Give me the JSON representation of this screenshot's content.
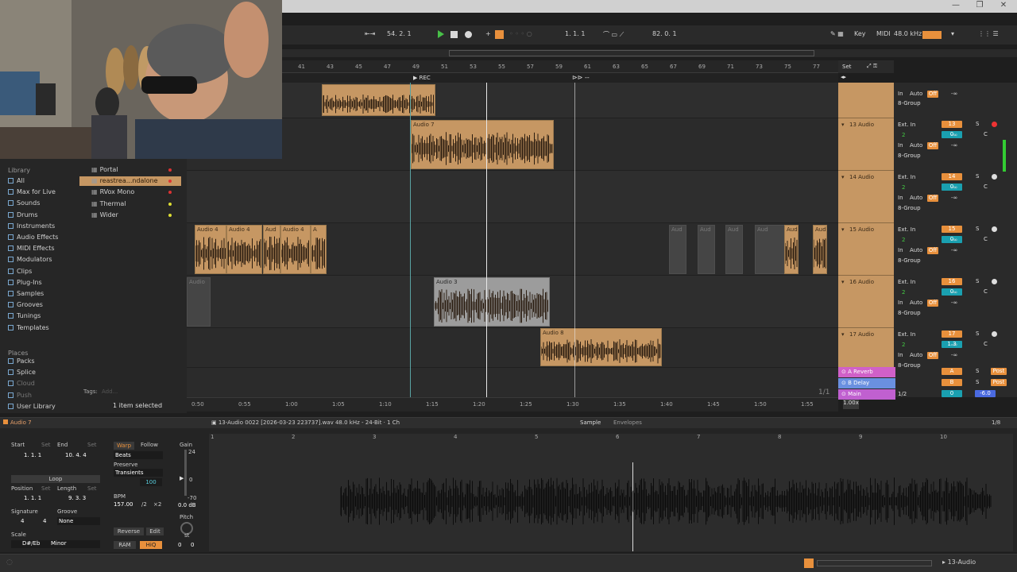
{
  "window": {
    "minimize": "—",
    "restore": "❐",
    "close": "✕"
  },
  "transport": {
    "loop_pos": "54.  2.  1",
    "position": "1.  1.  1",
    "tempo": "82.  0.  1",
    "key_label": "Key",
    "midi_label": "MIDI",
    "sample_rate": "48.0 kHz"
  },
  "ruler": {
    "bars": [
      "41",
      "43",
      "45",
      "47",
      "49",
      "51",
      "53",
      "55",
      "57",
      "59",
      "61",
      "63",
      "65",
      "67",
      "69",
      "71",
      "73",
      "75",
      "77"
    ],
    "rec_label": "REC",
    "set_label": "Set"
  },
  "time_ticks": [
    "0:50",
    "0:55",
    "1:00",
    "1:05",
    "1:10",
    "1:15",
    "1:20",
    "1:25",
    "1:30",
    "1:35",
    "1:40",
    "1:45",
    "1:50",
    "1:55"
  ],
  "browser": {
    "library_title": "Library",
    "items": [
      "All",
      "Max for Live",
      "Sounds",
      "Drums",
      "Instruments",
      "Audio Effects",
      "MIDI Effects",
      "Modulators",
      "Clips",
      "Plug-Ins",
      "Samples",
      "Grooves",
      "Tunings",
      "Templates"
    ],
    "places_title": "Places",
    "places": [
      "Packs",
      "Splice",
      "Cloud",
      "Push",
      "User Library"
    ],
    "folder_items": [
      "Portal",
      "reastrea...ndalone",
      "RVox Mono",
      "Thermal",
      "Wider"
    ],
    "tags_label": "Tags:",
    "tags_placeholder": "Add...",
    "selected_text": "1 item selected"
  },
  "clips": {
    "audio7": "Audio 7",
    "audio3": "Audio 3",
    "audio8": "Audio 8",
    "audio4a": "Audio 4",
    "audio4b": "Audio 4",
    "audio4c": "Aud",
    "audio4d": "Audio 4",
    "audio4e": "A",
    "audio_dim": "Audio",
    "aud": "Aud"
  },
  "tracks": [
    {
      "name": "13 Audio",
      "num": "13",
      "input": "Ext. In",
      "ch": "2",
      "vol": "0",
      "pan": "C"
    },
    {
      "name": "14 Audio",
      "num": "14",
      "input": "Ext. In",
      "ch": "2",
      "vol": "0",
      "pan": "C"
    },
    {
      "name": "15 Audio",
      "num": "15",
      "input": "Ext. In",
      "ch": "2",
      "vol": "0",
      "pan": "C"
    },
    {
      "name": "16 Audio",
      "num": "16",
      "input": "Ext. In",
      "ch": "2",
      "vol": "0",
      "pan": "C"
    },
    {
      "name": "17 Audio",
      "num": "17",
      "input": "Ext. In",
      "ch": "2",
      "vol": "1.3",
      "pan": "C"
    }
  ],
  "track_ctrl": {
    "in": "In",
    "auto": "Auto",
    "off": "Off",
    "group": "8-Group",
    "inf": "-∞",
    "s": "S"
  },
  "returns": [
    {
      "name": "A Reverb",
      "letter": "A",
      "post": "Post"
    },
    {
      "name": "B Delay",
      "letter": "B",
      "post": "Post"
    },
    {
      "name": "Main",
      "letter": "",
      "post": ""
    }
  ],
  "main_ratio": "1/2",
  "main_vol": "0",
  "main_db": "-6.0",
  "page_indicator": "1/1",
  "zoom": "1.00x",
  "detail": {
    "clip_name": "Audio 7",
    "file_info": "13-Audio 0022 [2026-03-23 223737].wav  48.0 kHz - 24-Bit · 1 Ch",
    "tab_sample": "Sample",
    "tab_envelopes": "Envelopes",
    "ratio": "1/8",
    "start_label": "Start",
    "end_label": "End",
    "set_label": "Set",
    "start_val": "1.   1.   1",
    "end_val": "10.   4.   4",
    "loop_label": "Loop",
    "position_label": "Position",
    "length_label": "Length",
    "pos_val": "1.   1.   1",
    "len_val": "9.   3.   3",
    "signature_label": "Signature",
    "groove_label": "Groove",
    "sig_num": "4",
    "sig_den": "4",
    "groove_val": "None",
    "scale_label": "Scale",
    "scale_key": "D#/Eb",
    "scale_mode": "Minor",
    "warp_label": "Warp",
    "follow_label": "Follow",
    "beats_label": "Beats",
    "preserve_label": "Preserve",
    "transients_label": "Transients",
    "transient_val": "100",
    "bpm_label": "BPM",
    "bpm_val": "157.00",
    "half": "/2",
    "double": "×2",
    "gain_label": "Gain",
    "gain_top": "24",
    "gain_zero": "0",
    "gain_bottom": "-70",
    "gain_db": "0.0 dB",
    "pitch_label": "Pitch",
    "pitch_st": "st",
    "reverse_label": "Reverse",
    "edit_label": "Edit",
    "ram_label": "RAM",
    "hiq_label": "HiQ",
    "pitch_val1": "0",
    "pitch_val2": "0",
    "bar_ticks": [
      "1",
      "2",
      "3",
      "4",
      "5",
      "6",
      "7",
      "8",
      "9",
      "10"
    ]
  },
  "status": {
    "track": "13-Audio"
  }
}
